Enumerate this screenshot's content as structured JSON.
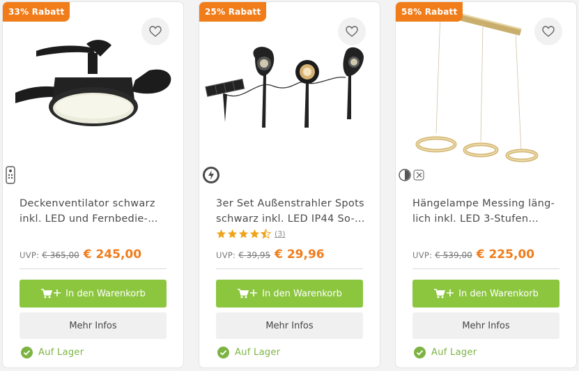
{
  "colors": {
    "accent": "#f07c1a",
    "green": "#8cc63f",
    "stock": "#7cb342"
  },
  "products": [
    {
      "badge": "33% Rabatt",
      "title": "Deckenventilator schwarz inkl. LED und Fernbedie-…",
      "uvp_label": "UVP:",
      "uvp": "€ 365,00",
      "price": "€ 245,00",
      "cart_label": "In den Warenkorb",
      "info_label": "Mehr Infos",
      "stock_label": "Auf Lager",
      "feature_icons": [
        "remote-control-icon"
      ]
    },
    {
      "badge": "25% Rabatt",
      "title": "3er Set Außenstrahler Spots schwarz inkl. LED IP44 So-…",
      "uvp_label": "UVP:",
      "uvp": "€ 39,95",
      "price": "€ 29,96",
      "rating_stars": 4.5,
      "rating_count": "(3)",
      "cart_label": "In den Warenkorb",
      "info_label": "Mehr Infos",
      "stock_label": "Auf Lager",
      "feature_icons": [
        "energy-icon"
      ]
    },
    {
      "badge": "58% Rabatt",
      "title": "Hängelampe Messing läng-lich inkl. LED 3-Stufen…",
      "title_display": "Hängelampe Messing läng- lich inkl. LED 3-Stufen…",
      "uvp_label": "UVP:",
      "uvp": "€ 539,00",
      "price": "€ 225,00",
      "cart_label": "In den Warenkorb",
      "info_label": "Mehr Infos",
      "stock_label": "Auf Lager",
      "feature_icons": [
        "dimmable-icon",
        "smart-icon"
      ]
    }
  ]
}
